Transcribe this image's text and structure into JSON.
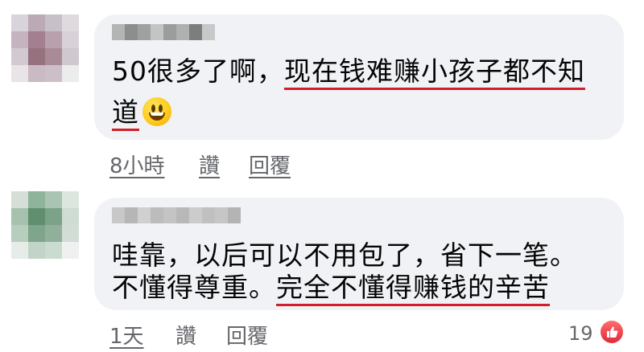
{
  "comments": [
    {
      "avatar_colors": [
        "#d9d4dc",
        "#bba9b6",
        "#c8c0c9",
        "#dedade",
        "#c6b3c0",
        "#a37f8f",
        "#b8a0ad",
        "#d8d2d8",
        "#d3c9d1",
        "#96727f",
        "#a98b97",
        "#d0c8cf",
        "#e8e4e8",
        "#c9bac4",
        "#cdbfc9",
        "#ececec"
      ],
      "name_colors": [
        "#b4b4b4",
        "#8d8d8d",
        "#a0a0a0",
        "#c4c4c4",
        "#9c9c9c",
        "#b0b0b0",
        "#7d7d7d",
        "#c8c8c8"
      ],
      "text_plain_1": "50很多了啊，",
      "text_underlined_1": "现在钱难赚小孩子都不知",
      "text_underlined_2": "道",
      "time": "8小時",
      "like": "讚",
      "reply": "回覆"
    },
    {
      "avatar_colors": [
        "#d5dfd8",
        "#8fb49c",
        "#a9c4b2",
        "#dde5df",
        "#a6c2ae",
        "#5f8f6e",
        "#7ca388",
        "#cfdcd3",
        "#b7cdbe",
        "#7fa58c",
        "#91b09b",
        "#d2ddd5",
        "#e6ece8",
        "#c2d4c7",
        "#cadbcf",
        "#eef1ef"
      ],
      "name_colors": [
        "#c8c8c8",
        "#b6b6b6",
        "#d0d0d0",
        "#bcbcbc",
        "#c4c4c4",
        "#b8b8b8",
        "#cccccc",
        "#c0c0c0",
        "#c6c6c6",
        "#b4b4b4"
      ],
      "text_line_1": "哇靠，以后可以不用包了，省下一笔。",
      "text_plain_2": "不懂得尊重。",
      "text_underlined_2": "完全不懂得赚钱的辛苦",
      "time": "1天",
      "like": "讚",
      "reply": "回覆",
      "like_count": "19"
    }
  ],
  "colors": {
    "bubble": "#f0f2f5",
    "underline": "#d11f2a",
    "meta_text": "#65676b",
    "like_icon": "#e02a3a"
  },
  "icons": [
    "smiling-emoji-icon",
    "thumbs-up-icon"
  ]
}
